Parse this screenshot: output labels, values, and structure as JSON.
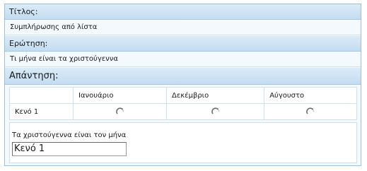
{
  "title_section": {
    "label": "Τίτλος:",
    "value": "Συμπλήρωσης από λίστα"
  },
  "question_section": {
    "label": "Ερώτηση:",
    "value": "Τι μήνα είναι τα χριστούγεννα"
  },
  "answer_section": {
    "label": "Απάντηση:",
    "columns": [
      "Ιανουάριο",
      "Δεκέμβριο",
      "Αύγουστο"
    ],
    "rows": [
      {
        "label": "Κενό 1"
      }
    ]
  },
  "fill_in": {
    "prompt": "Τα χριστούγεννα είναι τον μήνα",
    "value": "Κενό 1"
  },
  "colors": {
    "header_bg": "#c3dcf1",
    "panel_border": "#9ec0da",
    "cell_border": "#cfe1ef"
  }
}
